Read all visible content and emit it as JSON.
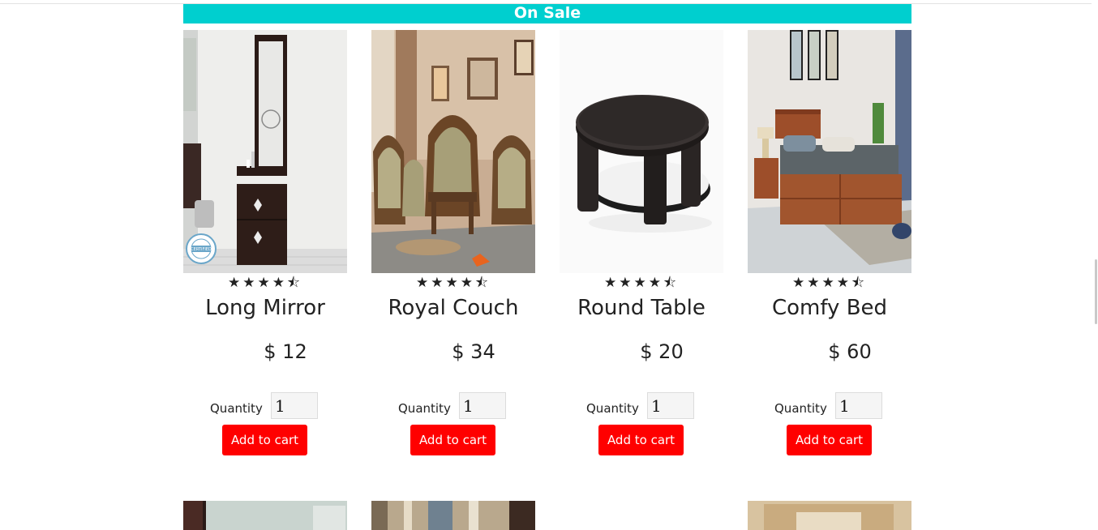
{
  "banner": {
    "title": "On Sale"
  },
  "products": [
    {
      "name": "Long Mirror",
      "price": "$ 12",
      "stars": "★★★★⯪",
      "rating": 4.5,
      "quantity_label": "Quantity",
      "quantity": "1",
      "button": "Add to cart",
      "badge_text": "CERTIFIED"
    },
    {
      "name": "Royal Couch",
      "price": "$ 34",
      "stars": "★★★★⯪",
      "rating": 4.5,
      "quantity_label": "Quantity",
      "quantity": "1",
      "button": "Add to cart"
    },
    {
      "name": "Round Table",
      "price": "$ 20",
      "stars": "★★★★⯪",
      "rating": 4.5,
      "quantity_label": "Quantity",
      "quantity": "1",
      "button": "Add to cart"
    },
    {
      "name": "Comfy Bed",
      "price": "$ 60",
      "stars": "★★★★⯪",
      "rating": 4.5,
      "quantity_label": "Quantity",
      "quantity": "1",
      "button": "Add to cart"
    }
  ],
  "colors": {
    "banner": "#00cfcf",
    "button": "#ff0000",
    "text": "#222222"
  }
}
